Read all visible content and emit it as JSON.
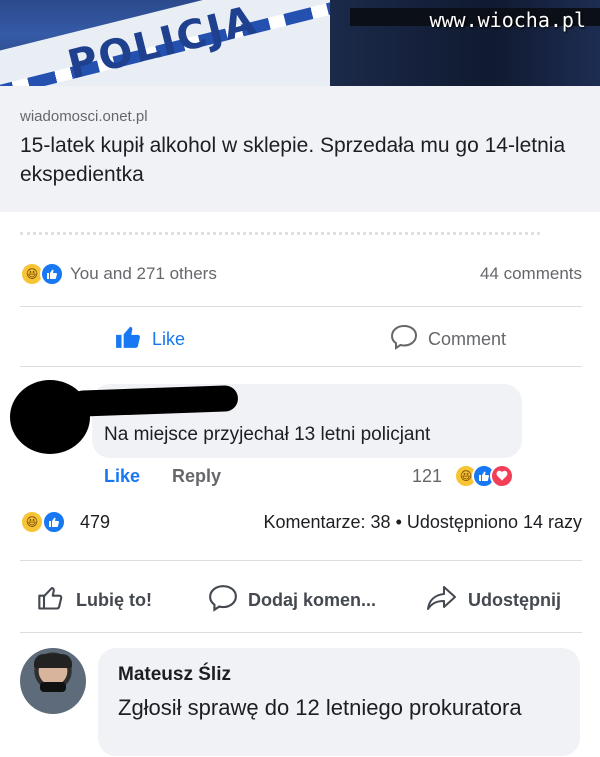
{
  "hero": {
    "car_text": "POLICJA",
    "watermark": "www.wiocha.pl"
  },
  "link_preview": {
    "domain": "wiadomosci.onet.pl",
    "title": "15-latek kupił alkohol w sklepie. Sprzedała mu go 14-letnia ekspedientka"
  },
  "post_summary": {
    "reaction_icons": [
      "haha-icon",
      "like-icon"
    ],
    "people_text": "You and 271 others",
    "comments_text": "44 comments"
  },
  "post_actions": {
    "like_label": "Like",
    "comment_label": "Comment"
  },
  "comment1": {
    "text": "Na miejsce przyjechał 13 letni policjant",
    "like_label": "Like",
    "reply_label": "Reply",
    "reaction_count": "121",
    "reaction_icons": [
      "haha-icon",
      "like-icon",
      "love-icon"
    ]
  },
  "share_summary": {
    "count": "479",
    "right_text": "Komentarze: 38 • Udostępniono 14 razy"
  },
  "share_actions": {
    "like_label": "Lubię to!",
    "comment_label": "Dodaj komen...",
    "share_label": "Udostępnij"
  },
  "comment2": {
    "author": "Mateusz Śliz",
    "text": "Zgłosił sprawę do 12 letniego prokuratora"
  },
  "colors": {
    "facebook_blue": "#1877f2",
    "text_primary": "#1c1e21",
    "text_secondary": "#65676b",
    "bubble_bg": "#f0f2f5"
  }
}
